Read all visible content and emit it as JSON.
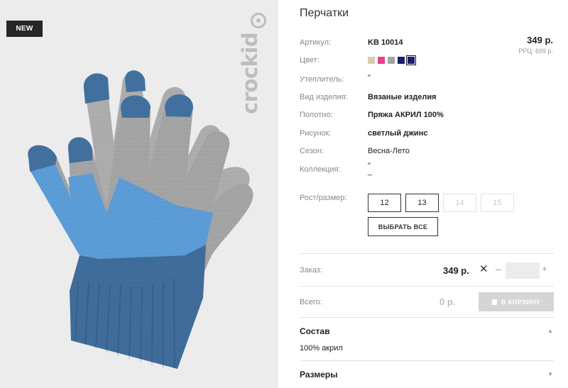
{
  "photo": {
    "badge": "NEW",
    "brand": "crockid"
  },
  "product": {
    "title": "Перчатки",
    "price": "349 р.",
    "rrp": "РРЦ: 699 р.",
    "properties": [
      {
        "label": "Артикул:",
        "value": "KB 10014",
        "bold": true
      },
      {
        "label": "Цвет:",
        "value": "",
        "bold": false
      },
      {
        "label": "Утеплитель:",
        "value": "\"",
        "bold": false
      },
      {
        "label": "Вид изделия:",
        "value": "Вязаные изделия",
        "bold": true
      },
      {
        "label": "Полотно:",
        "value": "Пряжа АКРИЛ 100%",
        "bold": true
      },
      {
        "label": "Рисунок:",
        "value": "светлый джинс",
        "bold": true
      },
      {
        "label": "Сезон:",
        "value": "Весна-Лето",
        "bold": false
      },
      {
        "label": "Коллекция:",
        "value": "\"\n_",
        "bold": false
      }
    ],
    "colors": [
      "#d8ccaa",
      "#e9408e",
      "#a6a6a6",
      "#1b1e6e",
      "#1b1e6e"
    ],
    "size_label": "Рост/размер:",
    "sizes": [
      {
        "label": "12",
        "available": true
      },
      {
        "label": "13",
        "available": true
      },
      {
        "label": "14",
        "available": false
      },
      {
        "label": "15",
        "available": false
      }
    ],
    "select_all": "ВЫБРАТЬ ВСЕ"
  },
  "order": {
    "label": "Заказ:",
    "price": "349 р.",
    "times": "✕",
    "minus": "–",
    "plus": "+",
    "qty_value": ""
  },
  "total": {
    "label": "Всего:",
    "value": "0 р.",
    "cart_label": "В КОРЗИНУ"
  },
  "sections": {
    "composition_title": "Состав",
    "composition_text": "100% акрил",
    "sizes_title": "Размеры",
    "chev_up": "▲",
    "chev_down": "▼"
  }
}
